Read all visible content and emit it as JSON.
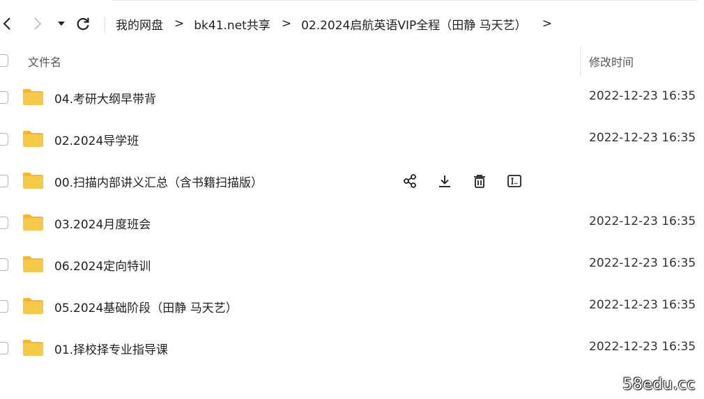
{
  "breadcrumb": {
    "items": [
      "我的网盘",
      "bk41.net共享",
      "02.2024启航英语VIP全程（田静 马天艺）"
    ],
    "separator": ">",
    "trailing": ">"
  },
  "header": {
    "name_col": "文件名",
    "time_col": "修改时间"
  },
  "files": [
    {
      "name": "04.考研大纲早带背",
      "modified": "2022-12-23 16:35"
    },
    {
      "name": "02.2024导学班",
      "modified": "2022-12-23 16:35"
    },
    {
      "name": "00.扫描内部讲义汇总（含书籍扫描版）",
      "modified": ""
    },
    {
      "name": "03.2024月度班会",
      "modified": "2022-12-23 16:35"
    },
    {
      "name": "06.2024定向特训",
      "modified": "2022-12-23 16:35"
    },
    {
      "name": "05.2024基础阶段（田静 马天艺）",
      "modified": "2022-12-23 16:35"
    },
    {
      "name": "01.择校择专业指导课",
      "modified": "2022-12-23 16:35"
    }
  ],
  "hover_actions": [
    "share-icon",
    "download-icon",
    "delete-icon",
    "rename-icon"
  ],
  "colors": {
    "folder": "#f7c948",
    "folder_tab": "#f2b733",
    "text": "#222222"
  },
  "watermark": "58edu.cc"
}
